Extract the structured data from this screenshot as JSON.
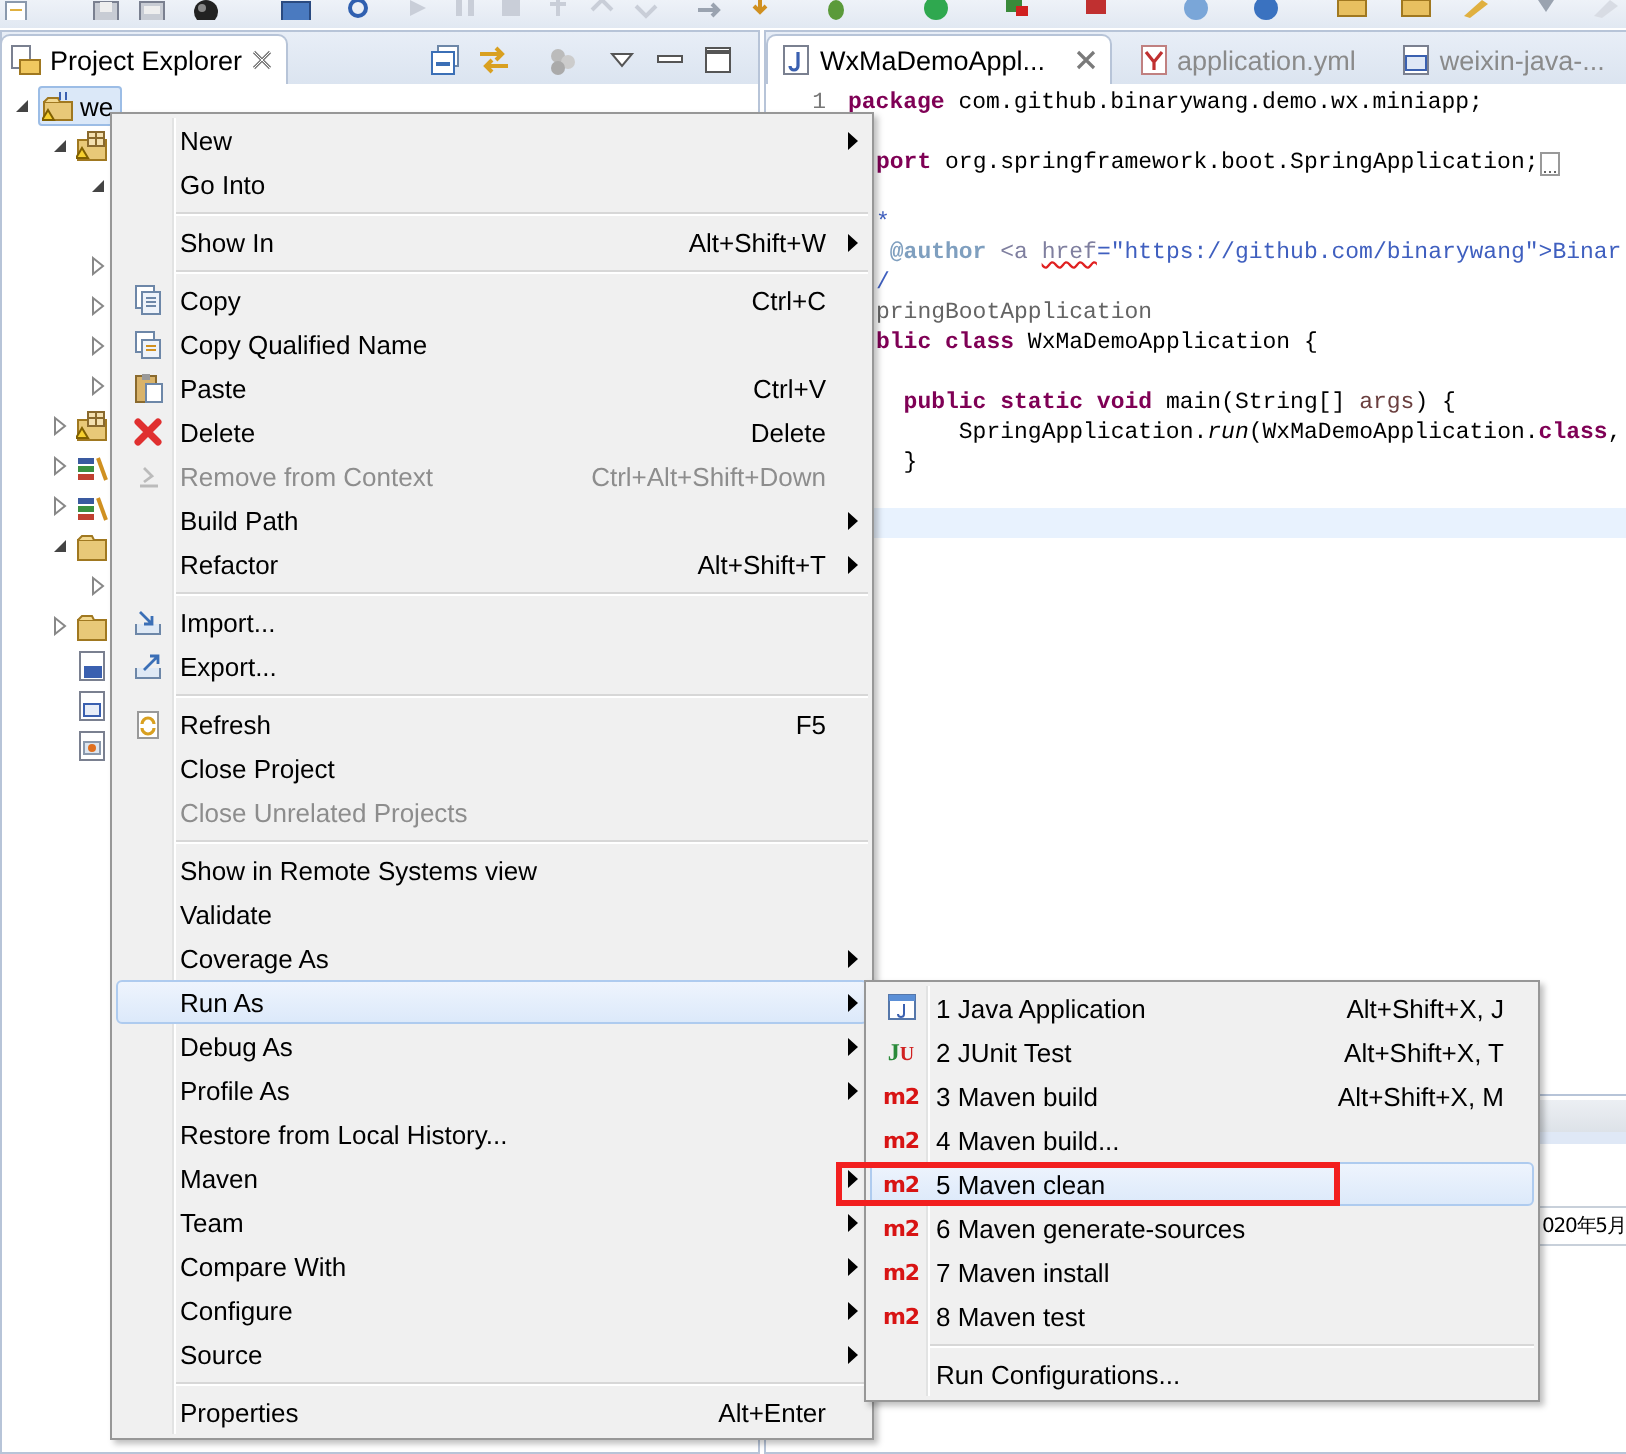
{
  "explorer": {
    "title": "Project Explorer",
    "tree": [
      {
        "kind": "project",
        "label": "we",
        "selected": true,
        "expanded": true,
        "children": [
          {
            "kind": "package-folder",
            "expanded": true,
            "children": [
              {
                "expanded": true
              },
              {
                "expanded": false
              },
              {
                "expanded": false
              },
              {
                "expanded": false
              },
              {
                "expanded": false
              }
            ]
          },
          {
            "kind": "package-folder",
            "expanded": false
          },
          {
            "kind": "library",
            "expanded": false
          },
          {
            "kind": "library",
            "expanded": false
          },
          {
            "kind": "folder",
            "expanded": true,
            "children": [
              {
                "expanded": false
              }
            ]
          },
          {
            "kind": "folder",
            "expanded": false
          },
          {
            "kind": "pom"
          },
          {
            "kind": "doc"
          },
          {
            "kind": "image"
          }
        ]
      }
    ]
  },
  "editor": {
    "tabs": [
      {
        "label": "WxMaDemoAppl...",
        "selected": true
      },
      {
        "label": "application.yml",
        "selected": false
      },
      {
        "label": "weixin-java-...",
        "selected": false
      }
    ],
    "lines": [
      {
        "number": "1",
        "current": false,
        "gap": false,
        "cut": false,
        "tokens": [
          {
            "text": "package",
            "kind": "keyword"
          },
          {
            "text": " com.github.binarywang.demo.wx.miniapp;",
            "kind": "plain"
          }
        ]
      },
      {
        "current": false,
        "gap": true,
        "cut": true,
        "folded": true,
        "tokens": [
          {
            "text": "port",
            "kind": "keyword"
          },
          {
            "text": " org.springframework.boot.SpringApplication;",
            "kind": "plain"
          }
        ]
      },
      {
        "current": false,
        "gap": true,
        "cut": true,
        "tokens": [
          {
            "text": "*",
            "kind": "javadoc"
          }
        ]
      },
      {
        "current": false,
        "gap": false,
        "cut": true,
        "tokens": [
          {
            "text": " @author",
            "kind": "javadoc-tag"
          },
          {
            "text": " <a ",
            "kind": "tag"
          },
          {
            "text": "href",
            "kind": "misspelled"
          },
          {
            "text": "=\"https://github.com/binarywang\">",
            "kind": "link"
          },
          {
            "text": "Binar",
            "kind": "javadoc"
          }
        ]
      },
      {
        "current": false,
        "gap": false,
        "cut": true,
        "tokens": [
          {
            "text": "/",
            "kind": "javadoc"
          }
        ]
      },
      {
        "current": false,
        "gap": false,
        "cut": true,
        "tokens": [
          {
            "text": "pringBootApplication",
            "kind": "annotation"
          }
        ]
      },
      {
        "current": false,
        "gap": false,
        "cut": true,
        "tokens": [
          {
            "text": "blic",
            "kind": "keyword"
          },
          {
            "text": " class",
            "kind": "keyword"
          },
          {
            "text": " WxMaDemoApplication {",
            "kind": "plain"
          }
        ]
      },
      {
        "current": false,
        "gap": true,
        "cut": true,
        "tokens": [
          {
            "text": "  public",
            "kind": "keyword"
          },
          {
            "text": " static",
            "kind": "keyword"
          },
          {
            "text": " void",
            "kind": "keyword"
          },
          {
            "text": " main(String[] ",
            "kind": "plain"
          },
          {
            "text": "args",
            "kind": "param"
          },
          {
            "text": ") {",
            "kind": "plain"
          }
        ]
      },
      {
        "current": false,
        "gap": false,
        "cut": true,
        "tokens": [
          {
            "text": "      SpringApplication.",
            "kind": "plain"
          },
          {
            "text": "run",
            "kind": "method"
          },
          {
            "text": "(WxMaDemoApplication.",
            "kind": "plain"
          },
          {
            "text": "class",
            "kind": "keyword"
          },
          {
            "text": ",",
            "kind": "plain"
          }
        ]
      },
      {
        "current": false,
        "gap": false,
        "cut": true,
        "tokens": [
          {
            "text": "  }",
            "kind": "plain"
          }
        ]
      },
      {
        "current": true,
        "gap": true
      }
    ],
    "bottom_panel": {
      "text": "020年5月"
    }
  },
  "context_menu": {
    "items": [
      {
        "kind": "item",
        "label": "New",
        "submenu": true,
        "disabled": false,
        "selected": false
      },
      {
        "kind": "item",
        "label": "Go Into",
        "submenu": false,
        "disabled": false,
        "selected": false
      },
      {
        "kind": "separator"
      },
      {
        "kind": "item",
        "label": "Show In",
        "shortcut": "Alt+Shift+W",
        "submenu": true,
        "disabled": false,
        "selected": false
      },
      {
        "kind": "separator"
      },
      {
        "kind": "item",
        "label": "Copy",
        "shortcut": "Ctrl+C",
        "submenu": false,
        "disabled": false,
        "selected": false
      },
      {
        "kind": "item",
        "label": "Copy Qualified Name",
        "submenu": false,
        "disabled": false,
        "selected": false
      },
      {
        "kind": "item",
        "label": "Paste",
        "shortcut": "Ctrl+V",
        "submenu": false,
        "disabled": false,
        "selected": false
      },
      {
        "kind": "item",
        "label": "Delete",
        "shortcut": "Delete",
        "submenu": false,
        "disabled": false,
        "selected": false
      },
      {
        "kind": "item",
        "label": "Remove from Context",
        "shortcut": "Ctrl+Alt+Shift+Down",
        "submenu": false,
        "disabled": true,
        "selected": false
      },
      {
        "kind": "item",
        "label": "Build Path",
        "submenu": true,
        "disabled": false,
        "selected": false
      },
      {
        "kind": "item",
        "label": "Refactor",
        "shortcut": "Alt+Shift+T",
        "submenu": true,
        "disabled": false,
        "selected": false
      },
      {
        "kind": "separator"
      },
      {
        "kind": "item",
        "label": "Import...",
        "submenu": false,
        "disabled": false,
        "selected": false
      },
      {
        "kind": "item",
        "label": "Export...",
        "submenu": false,
        "disabled": false,
        "selected": false
      },
      {
        "kind": "separator"
      },
      {
        "kind": "item",
        "label": "Refresh",
        "shortcut": "F5",
        "submenu": false,
        "disabled": false,
        "selected": false
      },
      {
        "kind": "item",
        "label": "Close Project",
        "submenu": false,
        "disabled": false,
        "selected": false
      },
      {
        "kind": "item",
        "label": "Close Unrelated Projects",
        "submenu": false,
        "disabled": true,
        "selected": false
      },
      {
        "kind": "separator"
      },
      {
        "kind": "item",
        "label": "Show in Remote Systems view",
        "submenu": false,
        "disabled": false,
        "selected": false
      },
      {
        "kind": "item",
        "label": "Validate",
        "submenu": false,
        "disabled": false,
        "selected": false
      },
      {
        "kind": "item",
        "label": "Coverage As",
        "submenu": true,
        "disabled": false,
        "selected": false
      },
      {
        "kind": "item",
        "label": "Run As",
        "submenu": true,
        "disabled": false,
        "selected": true
      },
      {
        "kind": "item",
        "label": "Debug As",
        "submenu": true,
        "disabled": false,
        "selected": false
      },
      {
        "kind": "item",
        "label": "Profile As",
        "submenu": true,
        "disabled": false,
        "selected": false
      },
      {
        "kind": "item",
        "label": "Restore from Local History...",
        "submenu": false,
        "disabled": false,
        "selected": false
      },
      {
        "kind": "item",
        "label": "Maven",
        "submenu": true,
        "disabled": false,
        "selected": false
      },
      {
        "kind": "item",
        "label": "Team",
        "submenu": true,
        "disabled": false,
        "selected": false
      },
      {
        "kind": "item",
        "label": "Compare With",
        "submenu": true,
        "disabled": false,
        "selected": false
      },
      {
        "kind": "item",
        "label": "Configure",
        "submenu": true,
        "disabled": false,
        "selected": false
      },
      {
        "kind": "item",
        "label": "Source",
        "submenu": true,
        "disabled": false,
        "selected": false
      },
      {
        "kind": "separator"
      },
      {
        "kind": "item",
        "label": "Properties",
        "shortcut": "Alt+Enter",
        "submenu": false,
        "disabled": false,
        "selected": false
      }
    ]
  },
  "run_as_menu": {
    "items": [
      {
        "kind": "item",
        "label": "1 Java Application",
        "shortcut": "Alt+Shift+X, J",
        "selected": false,
        "highlighted": false
      },
      {
        "kind": "item",
        "icon_text": "JU",
        "label": "2 JUnit Test",
        "shortcut": "Alt+Shift+X, T",
        "selected": false,
        "highlighted": false
      },
      {
        "kind": "item",
        "icon_text": "m2",
        "label": "3 Maven build",
        "shortcut": "Alt+Shift+X, M",
        "selected": false,
        "highlighted": false
      },
      {
        "kind": "item",
        "icon_text": "m2",
        "label": "4 Maven build...",
        "selected": false,
        "highlighted": false
      },
      {
        "kind": "item",
        "icon_text": "m2",
        "label": "5 Maven clean",
        "selected": true,
        "highlighted": true
      },
      {
        "kind": "item",
        "icon_text": "m2",
        "label": "6 Maven generate-sources",
        "selected": false,
        "highlighted": false
      },
      {
        "kind": "item",
        "icon_text": "m2",
        "label": "7 Maven install",
        "selected": false,
        "highlighted": false
      },
      {
        "kind": "item",
        "icon_text": "m2",
        "label": "8 Maven test",
        "selected": false,
        "highlighted": false
      },
      {
        "kind": "separator"
      },
      {
        "kind": "item",
        "label": "Run Configurations...",
        "selected": false,
        "highlighted": false
      }
    ]
  }
}
